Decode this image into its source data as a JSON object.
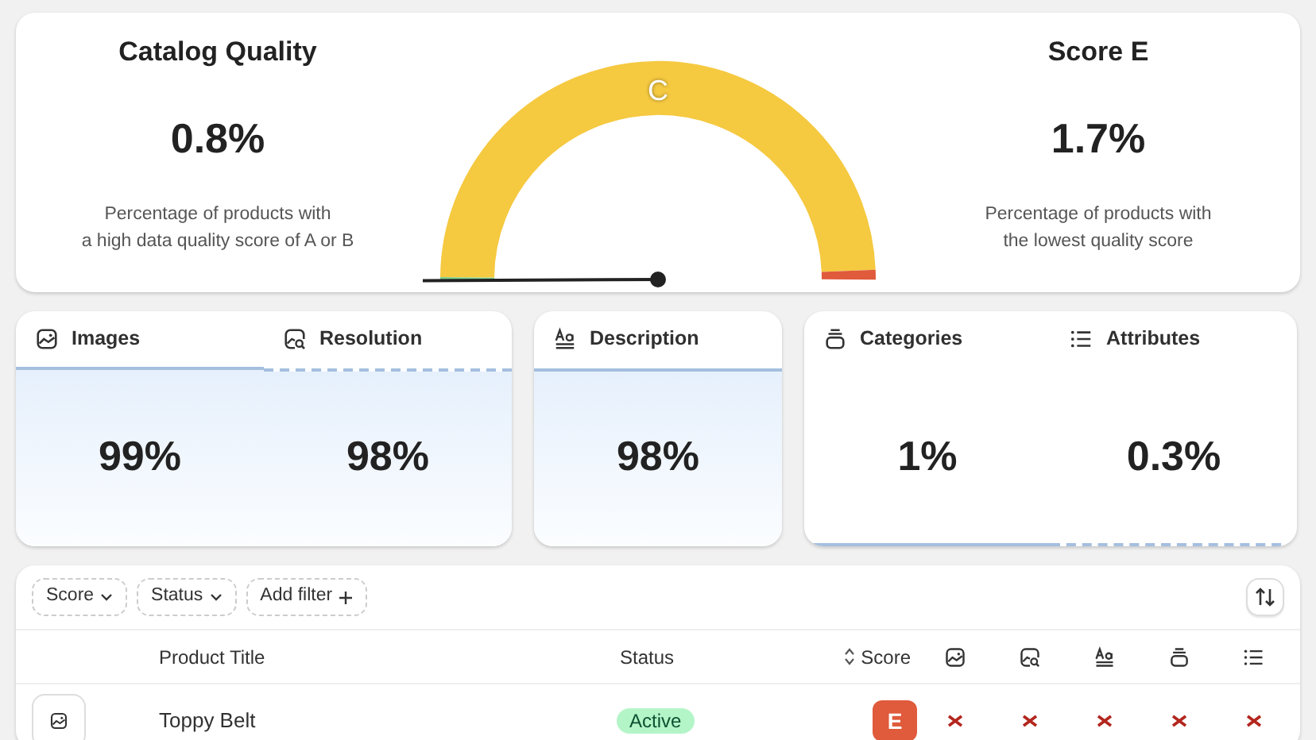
{
  "summary": {
    "left": {
      "title": "Catalog Quality",
      "value": "0.8%",
      "caption": "Percentage of products with\na high data quality score of A or B"
    },
    "gauge": {
      "grade": "C"
    },
    "right": {
      "title": "Score E",
      "value": "1.7%",
      "caption": "Percentage of products with\nthe lowest quality score"
    }
  },
  "metric_groups": [
    {
      "metrics": [
        {
          "kind": "image",
          "label": "Images",
          "value": "99%"
        },
        {
          "kind": "image-search",
          "label": "Resolution",
          "value": "98%"
        }
      ]
    },
    {
      "metrics": [
        {
          "kind": "text",
          "label": "Description",
          "value": "98%"
        }
      ]
    },
    {
      "metrics": [
        {
          "kind": "stack",
          "label": "Categories",
          "value": "1%"
        },
        {
          "kind": "list",
          "label": "Attributes",
          "value": "0.3%"
        }
      ]
    }
  ],
  "filters": [
    {
      "kind": "dropdown",
      "label": "Score"
    },
    {
      "kind": "dropdown",
      "label": "Status"
    },
    {
      "kind": "add",
      "label": "Add filter"
    }
  ],
  "table": {
    "columns": [
      {
        "kind": "text",
        "label": "Product Title"
      },
      {
        "kind": "text",
        "label": "Status"
      },
      {
        "kind": "sort",
        "label": "Score"
      },
      {
        "kind": "image"
      },
      {
        "kind": "image-search"
      },
      {
        "kind": "text"
      },
      {
        "kind": "stack"
      },
      {
        "kind": "list"
      }
    ],
    "rows": [
      {
        "title": "Toppy Belt",
        "status": "Active",
        "score": "E",
        "checks": [
          {
            "passed": false
          },
          {
            "passed": false
          },
          {
            "passed": false
          },
          {
            "passed": false
          },
          {
            "passed": false
          }
        ]
      }
    ]
  }
}
